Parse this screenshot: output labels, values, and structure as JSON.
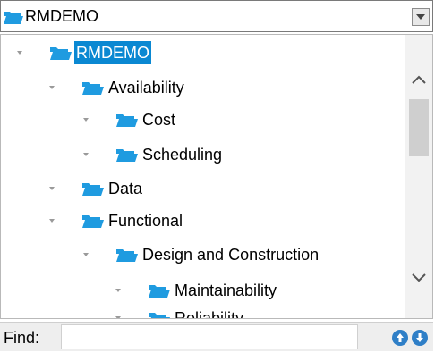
{
  "combo": {
    "selected": "RMDEMO",
    "icon": "folder-open-icon"
  },
  "tree": {
    "items": [
      {
        "label": "RMDEMO",
        "level": 0,
        "expanded": true,
        "selected": true
      },
      {
        "label": "Availability",
        "level": 1,
        "expanded": true,
        "selected": false
      },
      {
        "label": "Cost",
        "level": 2,
        "expanded": true,
        "selected": false
      },
      {
        "label": "Scheduling",
        "level": 2,
        "expanded": true,
        "selected": false
      },
      {
        "label": "Data",
        "level": 1,
        "expanded": true,
        "selected": false
      },
      {
        "label": "Functional",
        "level": 1,
        "expanded": true,
        "selected": false
      },
      {
        "label": "Design and Construction",
        "level": 2,
        "expanded": true,
        "selected": false
      },
      {
        "label": "Maintainability",
        "level": 3,
        "expanded": true,
        "selected": false
      },
      {
        "label": "Reliability",
        "level": 3,
        "expanded": true,
        "selected": false
      }
    ]
  },
  "find": {
    "label": "Find:",
    "value": ""
  },
  "colors": {
    "selection": "#0a88d2",
    "folder": "#1f9be0",
    "nav_button": "#2f7fc7"
  }
}
